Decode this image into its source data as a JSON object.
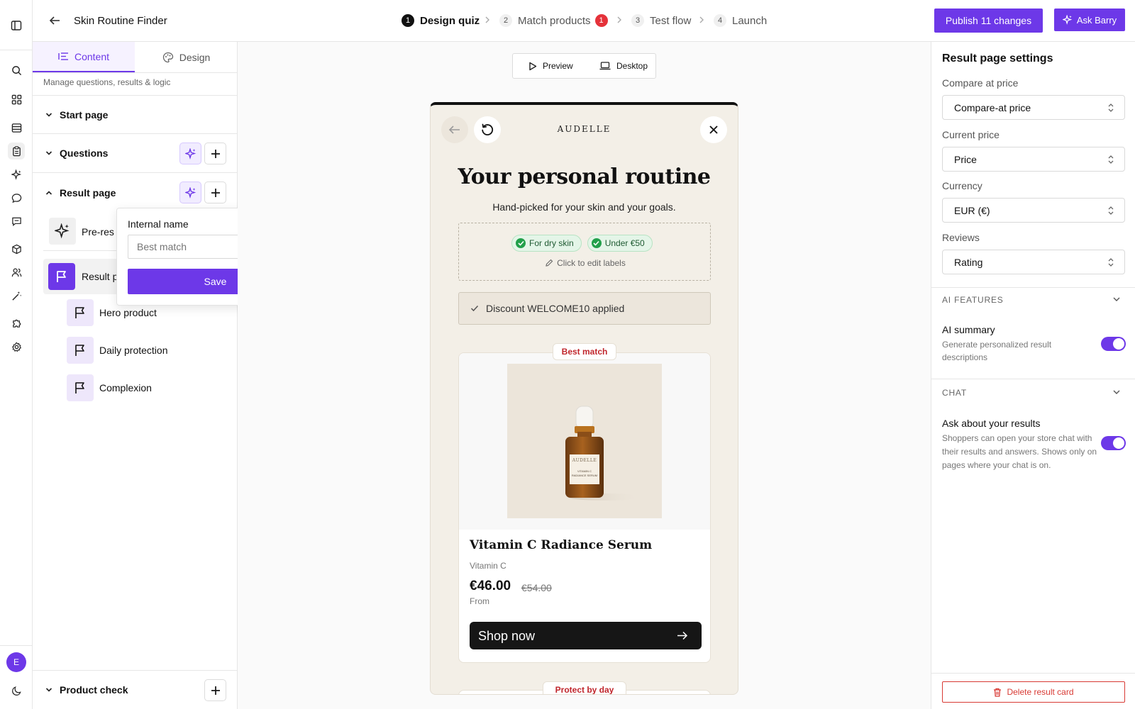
{
  "app": {
    "back_label": "",
    "title": "Skin Routine Finder",
    "publish_label": "Publish 11 changes",
    "ask_label": "Ask Barry",
    "user_initial": "E"
  },
  "steps": [
    {
      "num": "1",
      "label": "Design quiz",
      "active": true
    },
    {
      "num": "2",
      "label": "Match products",
      "badge": "1"
    },
    {
      "num": "3",
      "label": "Test flow"
    },
    {
      "num": "4",
      "label": "Launch"
    }
  ],
  "left": {
    "tabs": [
      "Content",
      "Design"
    ],
    "subtitle": "Manage questions, results & logic",
    "sections": {
      "start": "Start page",
      "questions": "Questions",
      "result": "Result page",
      "product_check": "Product check"
    },
    "items": {
      "pre_result": "Pre-res",
      "result_page": "Result p",
      "hero": "Hero product",
      "daily": "Daily protection",
      "complexion": "Complexion"
    },
    "popover": {
      "label": "Internal name",
      "placeholder": "Best match",
      "save": "Save"
    }
  },
  "canvas": {
    "preview": "Preview",
    "desktop": "Desktop",
    "brand": "AUDELLE",
    "heading": "Your personal routine",
    "subheading": "Hand-picked for your skin and your goals.",
    "chips": [
      "For dry skin",
      "Under €50"
    ],
    "edit_labels": "Click to edit labels",
    "discount": "Discount WELCOME10 applied",
    "card": {
      "badge": "Best match",
      "name": "Vitamin C Radiance Serum",
      "category": "Vitamin C",
      "price": "€46.00",
      "compare_price": "€54.00",
      "from": "From",
      "cta": "Shop now",
      "bottle_brand": "AUDELLE",
      "bottle_line1": "VITAMIN C",
      "bottle_line2": "RADIANCE SERUM"
    },
    "next_badge": "Protect by day"
  },
  "right": {
    "title": "Result page settings",
    "fields": [
      {
        "label": "Compare at price",
        "value": "Compare-at price"
      },
      {
        "label": "Current price",
        "value": "Price"
      },
      {
        "label": "Currency",
        "value": "EUR (€)"
      },
      {
        "label": "Reviews",
        "value": "Rating"
      }
    ],
    "ai_section": "AI FEATURES",
    "ai_summary_title": "AI summary",
    "ai_summary_desc": "Generate personalized result descriptions",
    "chat_section": "CHAT",
    "chat_title": "Ask about your results",
    "chat_desc": "Shoppers can open your store chat with their results and answers. Shows only on pages where your chat is on.",
    "delete_label": "Delete result card"
  },
  "colors": {
    "accent": "#6d38e8",
    "danger": "#d83a34",
    "phone_bg": "#f3efe7"
  }
}
